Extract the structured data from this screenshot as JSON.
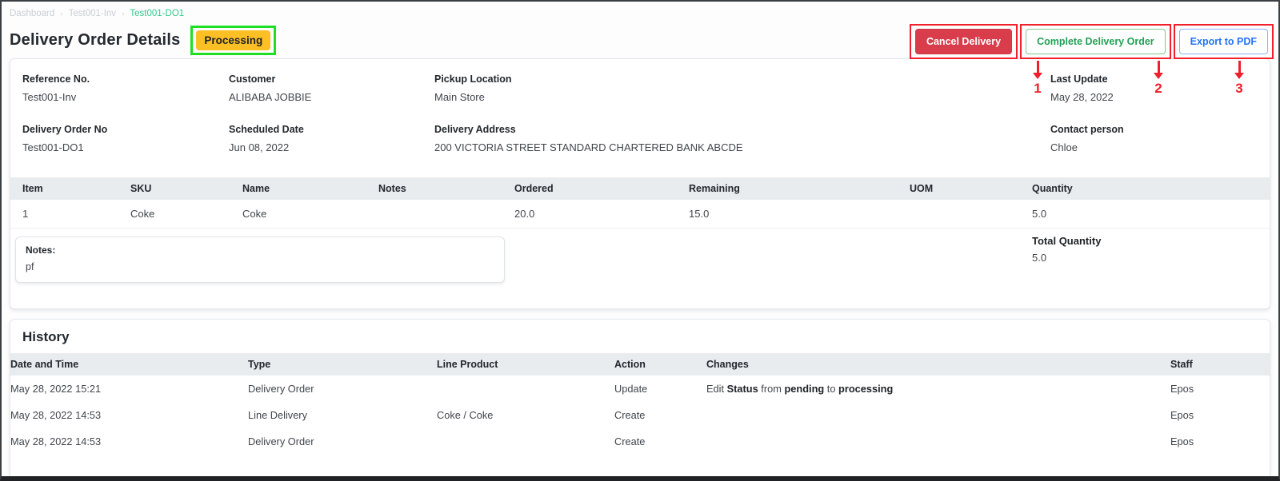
{
  "breadcrumb": {
    "separator": "›",
    "items": [
      {
        "label": "Dashboard"
      },
      {
        "label": "Test001-Inv"
      },
      {
        "label": "Test001-DO1"
      }
    ]
  },
  "header": {
    "title": "Delivery Order Details",
    "status": "Processing"
  },
  "actions": {
    "cancel": "Cancel Delivery",
    "complete": "Complete Delivery Order",
    "export": "Export to PDF"
  },
  "annotations": {
    "step1": "1",
    "step2": "2",
    "step3": "3"
  },
  "details": {
    "reference_label": "Reference No.",
    "reference_value": "Test001-Inv",
    "customer_label": "Customer",
    "customer_value": "ALIBABA JOBBIE",
    "pickup_label": "Pickup Location",
    "pickup_value": "Main Store",
    "last_update_label": "Last Update",
    "last_update_value": "May 28, 2022",
    "order_no_label": "Delivery Order No",
    "order_no_value": "Test001-DO1",
    "scheduled_label": "Scheduled Date",
    "scheduled_value": "Jun 08, 2022",
    "address_label": "Delivery Address",
    "address_value": "200 VICTORIA STREET STANDARD CHARTERED BANK ABCDE",
    "contact_label": "Contact person",
    "contact_value": "Chloe"
  },
  "items_table": {
    "headers": [
      "Item",
      "SKU",
      "Name",
      "Notes",
      "Ordered",
      "Remaining",
      "UOM",
      "Quantity"
    ],
    "rows": [
      {
        "item": "1",
        "sku": "Coke",
        "name": "Coke",
        "notes": "",
        "ordered": "20.0",
        "remaining": "15.0",
        "uom": "",
        "quantity": "5.0"
      }
    ],
    "notes_label": "Notes:",
    "notes_value": "pf",
    "total_label": "Total Quantity",
    "total_value": "5.0"
  },
  "history": {
    "title": "History",
    "headers": [
      "Date and Time",
      "Type",
      "Line Product",
      "Action",
      "Changes",
      "Staff"
    ],
    "rows": [
      {
        "datetime": "May 28, 2022 15:21",
        "type": "Delivery Order",
        "line_product": "",
        "action": "Update",
        "changes": {
          "p1": "Edit",
          "b1": "Status",
          "p2": "from",
          "b2": "pending",
          "p3": "to",
          "b3": "processing"
        },
        "staff": "Epos"
      },
      {
        "datetime": "May 28, 2022 14:53",
        "type": "Line Delivery",
        "line_product": "Coke / Coke",
        "action": "Create",
        "staff": "Epos"
      },
      {
        "datetime": "May 28, 2022 14:53",
        "type": "Delivery Order",
        "line_product": "",
        "action": "Create",
        "staff": "Epos"
      }
    ]
  },
  "colors": {
    "status_badge_bg": "#fcbf24",
    "badge_highlight_green": "#1fdf25",
    "annotation_red": "#f1202b",
    "cancel_button_bg": "#d93c4b",
    "complete_button_text": "#23a055",
    "export_button_text": "#2673f4",
    "breadcrumb_active": "#32c98d",
    "table_header_bg": "#e9ecef"
  }
}
